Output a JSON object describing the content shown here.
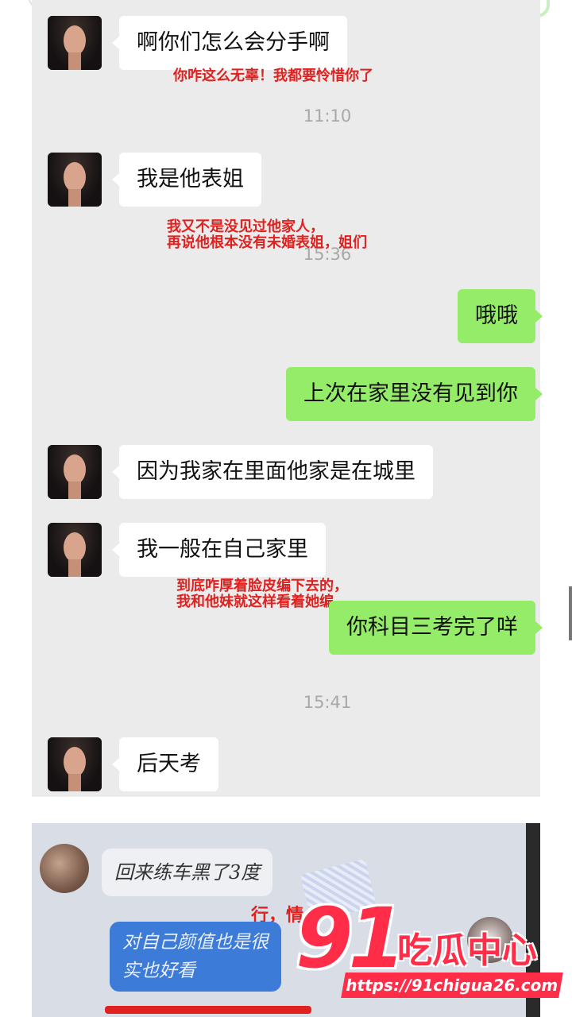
{
  "chat1": {
    "messages": [
      {
        "text": "啊你们怎么会分手啊"
      },
      {
        "text": "我是他表姐"
      },
      {
        "text": "哦哦"
      },
      {
        "text": "上次在家里没有见到你"
      },
      {
        "text": "因为我家在里面他家是在城里"
      },
      {
        "text": "我一般在自己家里"
      },
      {
        "text": "你科目三考完了咩"
      },
      {
        "text": "后天考"
      }
    ],
    "times": [
      "11:10",
      "15:36",
      "15:41"
    ],
    "notes": [
      {
        "lines": [
          "你咋这么无辜！我都要怜惜你了"
        ]
      },
      {
        "lines": [
          "我又不是没见过他家人，",
          "再说他根本没有未婚表姐，姐们"
        ]
      },
      {
        "lines": [
          "到底咋厚着脸皮编下去的，",
          "我和他妹就这样看着她编"
        ]
      }
    ]
  },
  "chat2": {
    "in_message": "回来练车黑了3度",
    "out_message_lines": [
      "对自己颜值也是很",
      "实也好看"
    ],
    "note": "行，情"
  },
  "watermark": {
    "number": "91",
    "text": "吃瓜中心",
    "url": "https://91chigua26.com"
  },
  "colors": {
    "panel_bg": "#ebebeb",
    "incoming_bubble": "#ffffff",
    "outgoing_bubble": "#95ec69",
    "timestamp": "#a8a8a8",
    "annotation_red": "#e0211f",
    "watermark_red": "#ff2d48",
    "blue_bubble": "#3d7bd8"
  }
}
